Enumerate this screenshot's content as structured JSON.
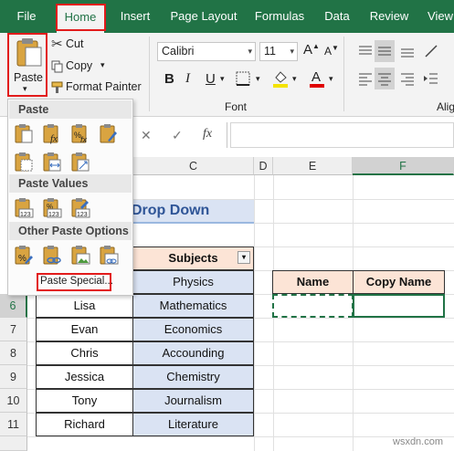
{
  "ribbon_tabs": [
    "File",
    "Home",
    "Insert",
    "Page Layout",
    "Formulas",
    "Data",
    "Review",
    "View"
  ],
  "clipboard": {
    "paste_label": "Paste",
    "cut_label": "Cut",
    "copy_label": "Copy",
    "format_painter_label": "Format Painter"
  },
  "font": {
    "name": "Calibri",
    "size": "11",
    "group_label": "Font",
    "bold": "B",
    "italic": "I",
    "underline": "U"
  },
  "alignment": {
    "group_label": "Alig"
  },
  "formula_bar": {
    "fx": "fx",
    "cancel": "✕",
    "enter": "✓"
  },
  "paste_menu": {
    "section_paste": "Paste",
    "section_paste_values": "Paste Values",
    "section_other": "Other Paste Options",
    "paste_special_label": "Paste Special..."
  },
  "columns": [
    "C",
    "D",
    "E",
    "F"
  ],
  "rows": [
    "6",
    "7",
    "8",
    "9",
    "10",
    "11"
  ],
  "sheet_title": "Drop Down",
  "table": {
    "header_subjects": "Subjects",
    "rows": [
      {
        "name": "",
        "subject": "Physics"
      },
      {
        "name": "Lisa",
        "subject": "Mathematics"
      },
      {
        "name": "Evan",
        "subject": "Economics"
      },
      {
        "name": "Chris",
        "subject": "Accounding"
      },
      {
        "name": "Jessica",
        "subject": "Chemistry"
      },
      {
        "name": "Tony",
        "subject": "Journalism"
      },
      {
        "name": "Richard",
        "subject": "Literature"
      }
    ]
  },
  "copy_table": {
    "name_header": "Name",
    "copy_name_header": "Copy Name"
  },
  "watermark": "wsxdn.com",
  "colors": {
    "excel_green": "#217346",
    "highlight_red": "#e21b1b",
    "peach": "#fce4d6",
    "light_blue": "#dae3f3"
  }
}
